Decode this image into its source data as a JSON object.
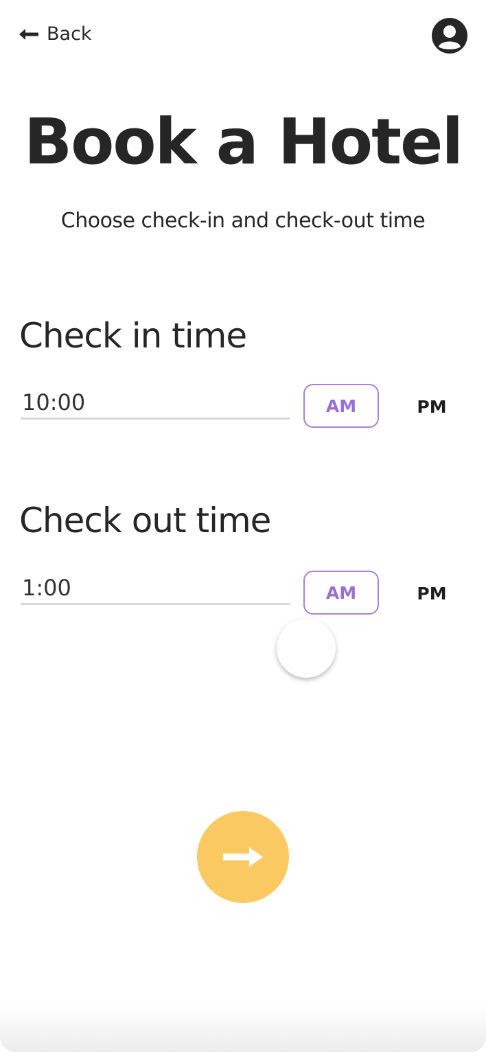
{
  "header": {
    "back_label": "Back",
    "back_icon": "arrow-left-icon",
    "profile_icon": "user-circle-icon"
  },
  "title": "Book a Hotel",
  "subtitle": "Choose check-in and check-out time",
  "check_in": {
    "heading": "Check in time",
    "value": "10:00",
    "am_label": "AM",
    "pm_label": "PM",
    "selected": "AM"
  },
  "check_out": {
    "heading": "Check out time",
    "value": "1:00",
    "am_label": "AM",
    "pm_label": "PM",
    "selected": "AM"
  },
  "next_button": {
    "icon": "arrow-right-icon"
  },
  "colors": {
    "accent_purple": "#a980de",
    "accent_yellow": "#fbc962",
    "text": "#262626"
  }
}
